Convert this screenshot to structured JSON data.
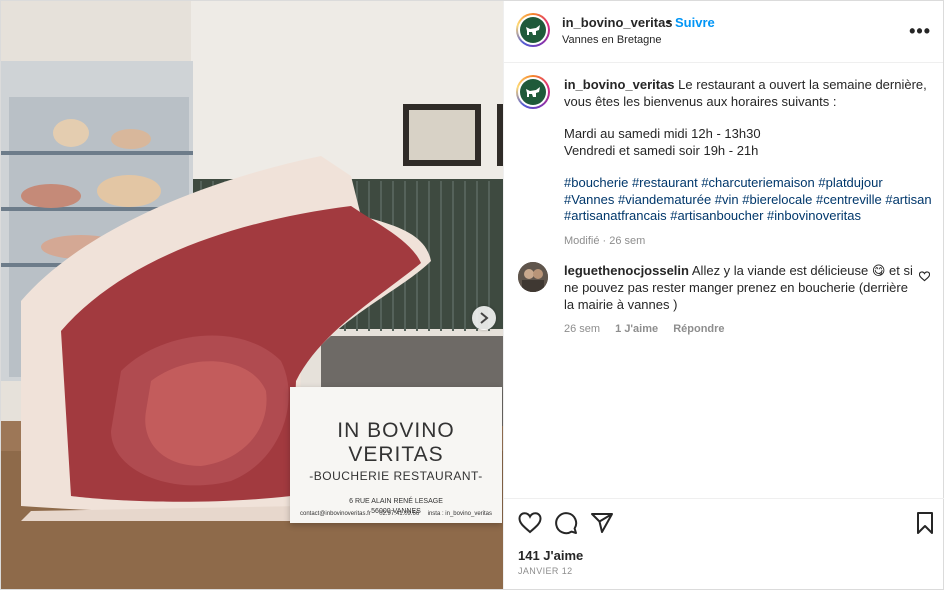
{
  "post": {
    "username": "in_bovino_veritas",
    "dot": "•",
    "follow_label": "Suivre",
    "location": "Vannes en Bretagne",
    "more_label": "•••"
  },
  "caption": {
    "username": "in_bovino_veritas",
    "line1": "Le restaurant a ouvert la semaine dernière, vous êtes les bienvenus aux horaires suivants :",
    "hours1": "Mardi au samedi midi 12h - 13h30",
    "hours2": "Vendredi et samedi soir 19h - 21h",
    "hashtags": "#boucherie #restaurant #charcuteriemaison #platdujour #Vannes #viandematurée #vin #bierelocale #centreville #artisan #artisanatfrancais #artisanboucher #inbovinoveritas",
    "meta": "Modifié · 26 sem"
  },
  "comment": {
    "username": "leguethenocjosselin",
    "text": "Allez y la viande est délicieuse 😋 et si ne pouvez pas rester manger prenez en boucherie (derrière la mairie à vannes )",
    "time": "26 sem",
    "likes": "1 J'aime",
    "reply": "Répondre"
  },
  "footer": {
    "likes": "141 J'aime",
    "date": "JANVIER 12"
  },
  "card": {
    "title": "IN BOVINO VERITAS",
    "subtitle": "-BOUCHERIE RESTAURANT-",
    "address1": "6 RUE ALAIN RENÉ LESAGE",
    "address2": "56000 VANNES",
    "email": "contact@inbovinoveritas.fr",
    "phone": "02.97.41.09.66",
    "insta": "insta : in_bovino_veritas"
  },
  "icons": {
    "like": "heart-icon",
    "comment": "comment-icon",
    "share": "send-icon",
    "save": "bookmark-icon",
    "next": "chevron-right-icon"
  }
}
